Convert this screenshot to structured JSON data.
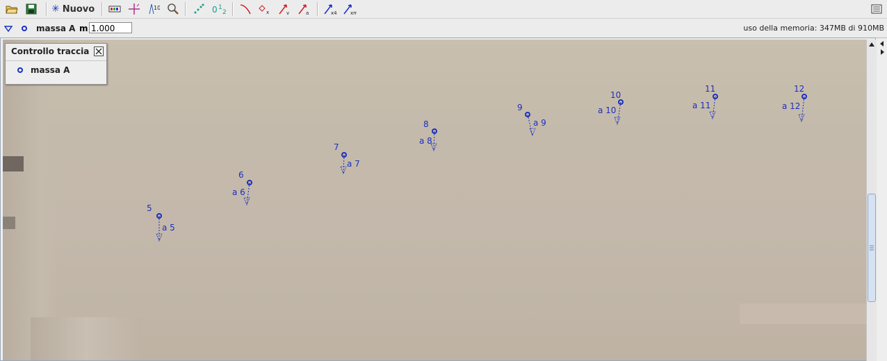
{
  "toolbar": {
    "new_label": "Nuovo",
    "buttons": [
      "open-icon",
      "save-icon",
      "new-track-icon",
      "clip-settings-icon",
      "axes-icon",
      "calibration-icon",
      "zoom-icon",
      "track-points-icon",
      "numbering-icon",
      "path-icon",
      "position-icon",
      "velocity-icon",
      "acceleration-icon",
      "vector-x4-icon",
      "vector-xm-icon",
      "menu-icon"
    ]
  },
  "trackbar": {
    "track_name": "massa A",
    "mass_label": "m",
    "mass_value": "1.000",
    "memory": "uso della memoria: 347MB di 910MB"
  },
  "track_control": {
    "title": "Controllo traccia",
    "item": "massa A"
  },
  "colors": {
    "track": "#1a2fbf",
    "thumb": "#d6e2f2"
  },
  "points": [
    {
      "frame": "5",
      "accel": "a 5"
    },
    {
      "frame": "6",
      "accel": "a 6"
    },
    {
      "frame": "7",
      "accel": "a 7"
    },
    {
      "frame": "8",
      "accel": "a 8"
    },
    {
      "frame": "9",
      "accel": "a 9"
    },
    {
      "frame": "10",
      "accel": "a 10"
    },
    {
      "frame": "11",
      "accel": "a 11"
    },
    {
      "frame": "12",
      "accel": "a 12"
    }
  ]
}
